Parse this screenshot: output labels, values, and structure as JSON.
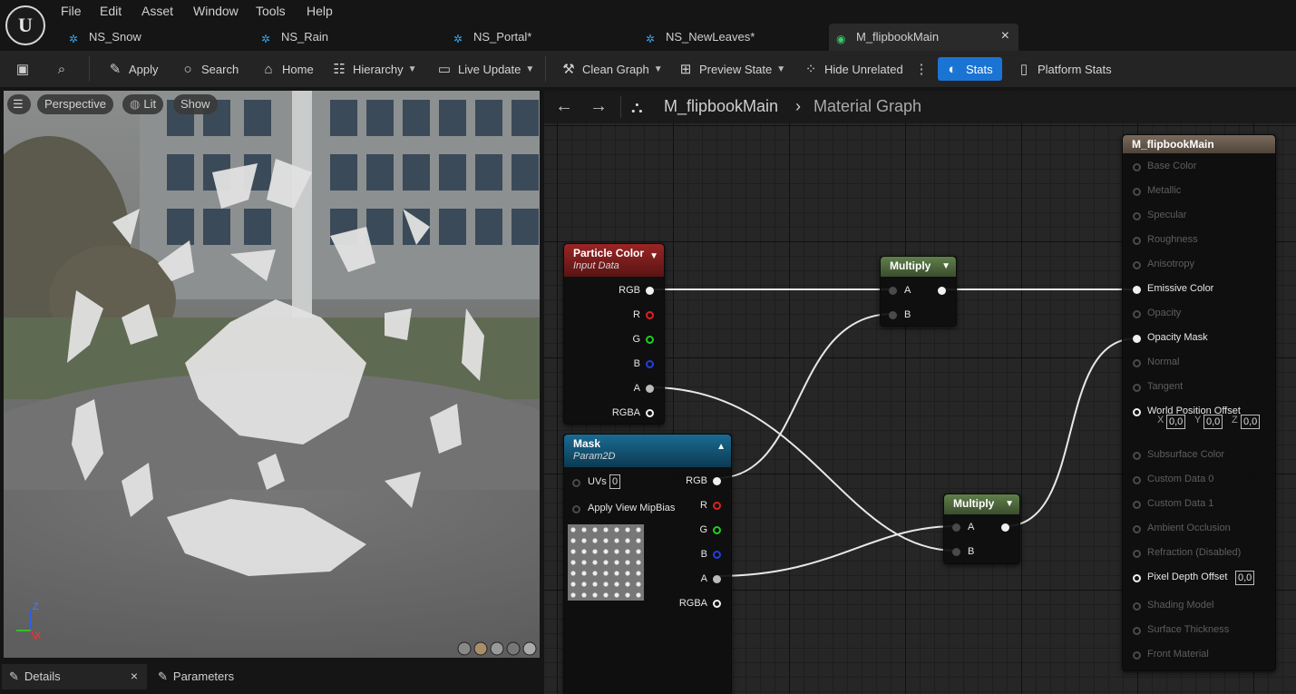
{
  "menu": [
    "File",
    "Edit",
    "Asset",
    "Window",
    "Tools",
    "Help"
  ],
  "tabs": [
    {
      "label": "NS_Snow"
    },
    {
      "label": "NS_Rain"
    },
    {
      "label": "NS_Portal*"
    },
    {
      "label": "NS_NewLeaves*"
    },
    {
      "label": "M_flipbookMain",
      "close": "×"
    }
  ],
  "toolbar": {
    "apply": "Apply",
    "search": "Search",
    "home": "Home",
    "hierarchy": "Hierarchy",
    "live_update": "Live Update",
    "clean_graph": "Clean Graph",
    "preview_state": "Preview State",
    "hide_unrelated": "Hide Unrelated",
    "stats": "Stats",
    "platform_stats": "Platform Stats"
  },
  "viewport": {
    "perspective": "Perspective",
    "lit": "Lit",
    "show": "Show",
    "axis_x": "X",
    "axis_z": "Z"
  },
  "bottom_tabs": {
    "details": "Details",
    "details_close": "×",
    "parameters": "Parameters"
  },
  "breadcrumb": {
    "asset": "M_flipbookMain",
    "graph": "Material Graph"
  },
  "nodes": {
    "particle_color": {
      "title": "Particle Color",
      "subtitle": "Input Data",
      "pins": [
        "RGB",
        "R",
        "G",
        "B",
        "A",
        "RGBA"
      ]
    },
    "mask": {
      "title": "Mask",
      "subtitle": "Param2D",
      "inputs": {
        "uvs": "UVs",
        "uvs_value": "0",
        "mip": "Apply View MipBias"
      },
      "pins": [
        "RGB",
        "R",
        "G",
        "B",
        "A",
        "RGBA"
      ]
    },
    "multiply1": {
      "title": "Multiply",
      "a": "A",
      "b": "B"
    },
    "multiply2": {
      "title": "Multiply",
      "a": "A",
      "b": "B"
    },
    "result": {
      "title": "M_flipbookMain",
      "pins": [
        {
          "label": "Base Color",
          "active": false
        },
        {
          "label": "Metallic",
          "active": false
        },
        {
          "label": "Specular",
          "active": false
        },
        {
          "label": "Roughness",
          "active": false
        },
        {
          "label": "Anisotropy",
          "active": false
        },
        {
          "label": "Emissive Color",
          "active": true
        },
        {
          "label": "Opacity",
          "active": false
        },
        {
          "label": "Opacity Mask",
          "active": true
        },
        {
          "label": "Normal",
          "active": false
        },
        {
          "label": "Tangent",
          "active": false
        },
        {
          "label": "World Position Offset",
          "active": true
        },
        {
          "label": "Subsurface Color",
          "active": false
        },
        {
          "label": "Custom Data 0",
          "active": false
        },
        {
          "label": "Custom Data 1",
          "active": false
        },
        {
          "label": "Ambient Occlusion",
          "active": false
        },
        {
          "label": "Refraction (Disabled)",
          "active": false
        },
        {
          "label": "Pixel Depth Offset",
          "active": true
        },
        {
          "label": "Shading Model",
          "active": false
        },
        {
          "label": "Surface Thickness",
          "active": false
        },
        {
          "label": "Front Material",
          "active": false
        }
      ],
      "wpo": {
        "x_label": "X",
        "x": "0,0",
        "y_label": "Y",
        "y": "0,0",
        "z_label": "Z",
        "z": "0,0"
      },
      "pdo_value": "0,0"
    }
  },
  "colors": {
    "accent": "#1a74d4",
    "particle_header": "#8a1d1d",
    "mask_header": "#0f4f6e",
    "multiply_header": "#4a6a3a",
    "result_header": "#6b5e52"
  }
}
